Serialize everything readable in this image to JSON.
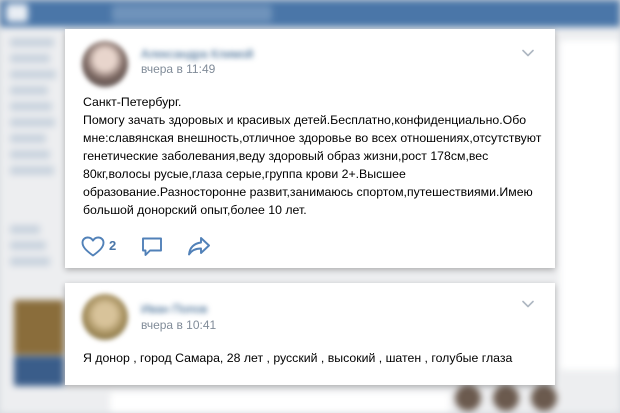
{
  "background": {
    "menu_count": 12
  },
  "posts": [
    {
      "author": "Александра Климой",
      "time": "вчера в 11:49",
      "text": "Санкт-Петербург.\nПомогу зачать здоровых и красивых детей.Бесплатно,конфиденциально.Обо\nмне:славянская внешность,отличное здоровье во всех отношениях,отсутствуют\nгенетические заболевания,веду здоровый образ жизни,рост 178см,вес\n80кг,волосы русые,глаза серые,группа крови 2+.Высшее\nобразование.Разносторонне развит,занимаюсь спортом,путешествиями.Имею\nбольшой донорский опыт,более 10 лет.",
      "likes": "2",
      "icons": {
        "like": "heart-icon",
        "comment": "comment-icon",
        "share": "share-icon",
        "menu": "chevron-down-icon"
      }
    },
    {
      "author": "Иван Попов",
      "time": "вчера в 10:41",
      "text": "Я донор , город Самара, 28 лет , русский , высокий , шатен , голубые глаза",
      "icons": {
        "menu": "chevron-down-icon"
      }
    }
  ],
  "colors": {
    "header": "#4a76a8",
    "link": "#2a5885",
    "muted": "#818c99",
    "icon": "#5181b8"
  }
}
